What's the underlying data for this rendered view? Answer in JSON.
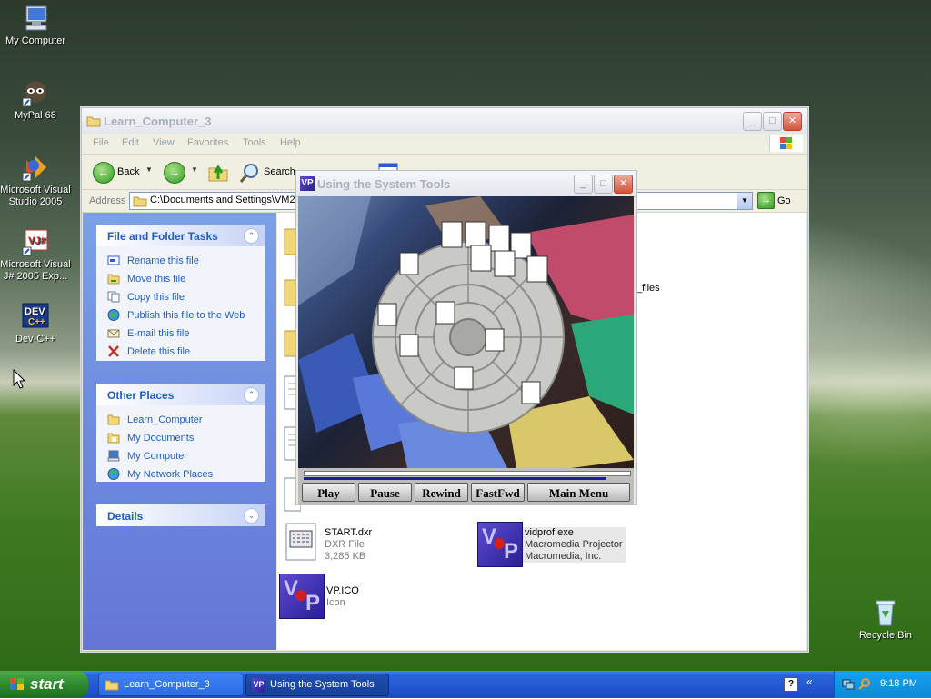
{
  "desktop": {
    "icons": [
      {
        "label": "My Computer"
      },
      {
        "label": "MyPal 68"
      },
      {
        "label": "Microsoft Visual Studio 2005"
      },
      {
        "label": "Microsoft Visual J# 2005 Exp..."
      },
      {
        "label": "Dev-C++"
      },
      {
        "label": "Recycle Bin"
      }
    ]
  },
  "explorer": {
    "title": "Learn_Computer_3",
    "menu": [
      "File",
      "Edit",
      "View",
      "Favorites",
      "Tools",
      "Help"
    ],
    "toolbar": {
      "back": "Back",
      "search": "Search"
    },
    "address": {
      "label": "Address",
      "value": "C:\\Documents and Settings\\VM2\\",
      "go": "Go"
    },
    "tasks": {
      "file_folder": {
        "title": "File and Folder Tasks",
        "items": [
          "Rename this file",
          "Move this file",
          "Copy this file",
          "Publish this file to the Web",
          "E-mail this file",
          "Delete this file"
        ]
      },
      "other_places": {
        "title": "Other Places",
        "items": [
          "Learn_Computer",
          "My Documents",
          "My Computer",
          "My Network Places"
        ]
      },
      "details": {
        "title": "Details"
      }
    },
    "files": [
      {
        "name": "_files"
      },
      {
        "name": "START.dxr",
        "type": "DXR File",
        "size": "3,285 KB"
      },
      {
        "name": "vidprof.exe",
        "type": "Macromedia Projector",
        "company": "Macromedia, Inc."
      },
      {
        "name": "VP.ICO",
        "type": "Icon"
      }
    ]
  },
  "player": {
    "title": "Using the System Tools",
    "buttons": [
      "Play",
      "Pause",
      "Rewind",
      "FastFwd",
      "Main Menu"
    ],
    "progress": 0.93
  },
  "taskbar": {
    "start": "start",
    "tasks": [
      "Learn_Computer_3",
      "Using the System Tools"
    ],
    "clock": "9:18 PM"
  }
}
